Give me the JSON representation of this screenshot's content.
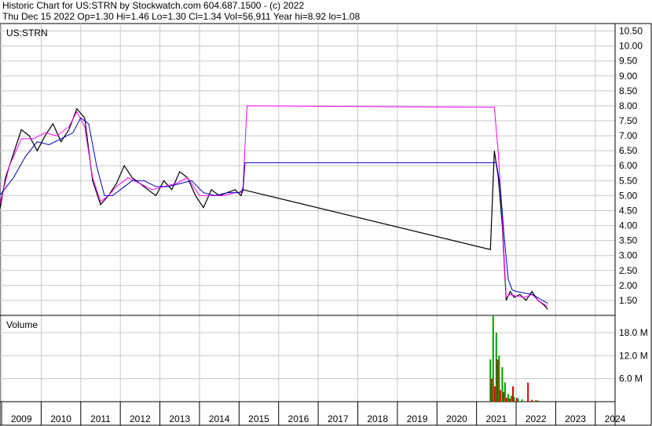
{
  "header": {
    "line1": "Historic Chart for US:STRN by Stockwatch.com 604.687.1500 - (c) 2022",
    "line2": "Thu Dec 15 2022  Op=1.30  Hi=1.46  Lo=1.30  Cl=1.34  Vol=56,911  Year hi=8.92  lo=1.08"
  },
  "chart_data": [
    {
      "type": "line",
      "title": "US:STRN",
      "ylim": [
        1.0,
        10.75
      ],
      "yticks": [
        "10.50",
        "10.00",
        "9.50",
        "9.00",
        "8.50",
        "8.00",
        "7.50",
        "7.00",
        "6.50",
        "6.00",
        "5.50",
        "5.00",
        "4.50",
        "4.00",
        "3.50",
        "3.00",
        "2.50",
        "2.00",
        "1.50"
      ],
      "xticks": [
        "2009",
        "2010",
        "2011",
        "2012",
        "2013",
        "2014",
        "2015",
        "2016",
        "2017",
        "2018",
        "2019",
        "2020",
        "2021",
        "2022",
        "2023",
        "2024"
      ],
      "grid": true,
      "series": [
        {
          "color": "#000000",
          "x": [
            2008.95,
            2009.1,
            2009.3,
            2009.5,
            2009.7,
            2009.9,
            2010.1,
            2010.3,
            2010.5,
            2010.7,
            2010.9,
            2011.1,
            2011.3,
            2011.5,
            2011.7,
            2011.9,
            2012.1,
            2012.3,
            2012.5,
            2012.7,
            2012.9,
            2013.1,
            2013.3,
            2013.5,
            2013.7,
            2013.9,
            2014.1,
            2014.3,
            2014.5,
            2014.7,
            2014.9,
            2015.05,
            2015.1,
            2021.35,
            2021.45,
            2021.55,
            2021.65,
            2021.75,
            2021.85,
            2021.95,
            2022.1,
            2022.25,
            2022.4,
            2022.55,
            2022.7,
            2022.8
          ],
          "y": [
            4.5,
            5.6,
            6.4,
            7.2,
            7.0,
            6.5,
            7.0,
            7.4,
            6.8,
            7.2,
            7.9,
            7.6,
            5.5,
            4.7,
            5.0,
            5.4,
            6.0,
            5.6,
            5.4,
            5.2,
            5.0,
            5.5,
            5.2,
            5.8,
            5.6,
            5.0,
            4.6,
            5.2,
            5.0,
            5.1,
            5.2,
            5.0,
            5.2,
            3.2,
            6.5,
            5.6,
            4.0,
            1.5,
            1.8,
            1.6,
            1.7,
            1.5,
            1.8,
            1.5,
            1.35,
            1.2
          ]
        },
        {
          "color": "#ff00ff",
          "x": [
            2008.95,
            2009.2,
            2009.5,
            2009.8,
            2010.1,
            2010.4,
            2010.7,
            2010.9,
            2011.1,
            2011.3,
            2011.5,
            2011.7,
            2011.9,
            2012.2,
            2012.5,
            2012.8,
            2013.1,
            2013.4,
            2013.7,
            2014.0,
            2014.3,
            2014.6,
            2014.9,
            2015.05,
            2015.1,
            2015.2,
            2021.45,
            2021.55,
            2021.65,
            2021.75,
            2021.85,
            2022.0,
            2022.2,
            2022.4,
            2022.6,
            2022.8
          ],
          "y": [
            4.7,
            6.0,
            6.9,
            6.9,
            7.1,
            7.0,
            7.3,
            7.8,
            7.3,
            5.6,
            4.8,
            5.0,
            5.3,
            5.6,
            5.4,
            5.2,
            5.3,
            5.4,
            5.6,
            5.0,
            5.0,
            5.0,
            5.1,
            5.1,
            5.3,
            8.0,
            7.95,
            6.4,
            4.2,
            1.6,
            1.7,
            1.65,
            1.6,
            1.7,
            1.45,
            1.3
          ]
        },
        {
          "color": "#0000c0",
          "x": [
            2008.95,
            2009.3,
            2009.6,
            2009.9,
            2010.2,
            2010.5,
            2010.8,
            2011.0,
            2011.2,
            2011.4,
            2011.6,
            2011.8,
            2012.0,
            2012.3,
            2012.6,
            2012.9,
            2013.2,
            2013.5,
            2013.8,
            2014.1,
            2014.4,
            2014.7,
            2015.0,
            2015.1,
            2015.15,
            2021.5,
            2021.6,
            2021.7,
            2021.8,
            2021.9,
            2022.0,
            2022.2,
            2022.4,
            2022.6,
            2022.8
          ],
          "y": [
            5.0,
            5.6,
            6.3,
            6.8,
            6.7,
            6.9,
            7.1,
            7.6,
            7.4,
            6.0,
            5.0,
            5.0,
            5.2,
            5.5,
            5.5,
            5.3,
            5.3,
            5.4,
            5.5,
            5.1,
            5.0,
            5.1,
            5.1,
            5.2,
            6.1,
            6.1,
            5.3,
            3.6,
            2.2,
            1.85,
            1.8,
            1.75,
            1.7,
            1.55,
            1.4
          ]
        }
      ]
    },
    {
      "type": "bar",
      "title": "Volume",
      "ylim": [
        0,
        22.5
      ],
      "yticks": [
        "18.0 M",
        "12.0 M",
        "6.0 M"
      ],
      "series": [
        {
          "color": "#00a000",
          "x": [
            2021.35,
            2021.42,
            2021.5,
            2021.57,
            2021.65,
            2021.72,
            2021.8,
            2021.88,
            2021.95,
            2022.05,
            2022.15,
            2022.3,
            2022.5
          ],
          "y": [
            11.0,
            24.0,
            18.0,
            12.0,
            9.0,
            5.0,
            2.0,
            1.5,
            1.2,
            0.8,
            0.6,
            0.5,
            0.4
          ]
        },
        {
          "color": "#e00000",
          "x": [
            2021.38,
            2021.46,
            2021.53,
            2021.6,
            2021.68,
            2021.76,
            2021.84,
            2021.92,
            2022.02,
            2022.3,
            2022.4,
            2022.55
          ],
          "y": [
            6.0,
            4.0,
            11.0,
            3.0,
            2.5,
            1.0,
            0.8,
            4.0,
            1.0,
            5.0,
            0.5,
            0.3
          ]
        }
      ]
    }
  ]
}
